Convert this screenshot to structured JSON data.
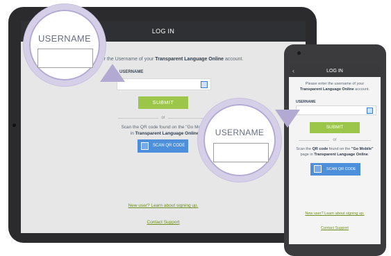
{
  "colors": {
    "device": "#2b2b2d",
    "accent_green": "#9bc64a",
    "accent_blue": "#4e8fdb",
    "link": "#6e8f1d",
    "magnifier_ring": "#b3aad3"
  },
  "tablet": {
    "header_title": "LOG IN",
    "instruction_prefix": "nter the Username of your ",
    "instruction_bold": "Transparent Language Online",
    "instruction_suffix": " account.",
    "username_label": "USERNAME",
    "submit_label": "SUBMIT",
    "or_label": "or",
    "scan_line1": "Scan the QR code found on the \"Go Mobile\"",
    "scan_line2_prefix": "in ",
    "scan_line2_bold": "Transparent Language Online",
    "scan_line2_suffix": ".",
    "scan_button_label": "SCAN QR CODE",
    "signup_link": "New user? Learn about signing up.",
    "support_link": "Contact Support"
  },
  "phone": {
    "header_title": "LOG IN",
    "back_icon": "chevron-left-icon",
    "instruction_line1": "Please enter the username of your",
    "instruction_bold": "Transparent Language Online",
    "instruction_suffix": " account.",
    "username_label": "USERNAME",
    "submit_label": "SUBMIT",
    "or_label": "or",
    "scan_prefix": "Scan the ",
    "scan_bold1": "QR code",
    "scan_mid": " found on the ",
    "scan_bold2": "\"Go Mobile\"",
    "scan_line2_prefix": "page in ",
    "scan_line2_bold": "Transparent Language Online",
    "scan_line2_suffix": ".",
    "scan_button_label": "SCAN QR CODE",
    "signup_link": "New user? Learn about signing up.",
    "support_link": "Contact Support"
  },
  "magnifier_tablet": {
    "title": "USERNAME"
  },
  "magnifier_phone": {
    "title": "USERNAME"
  }
}
